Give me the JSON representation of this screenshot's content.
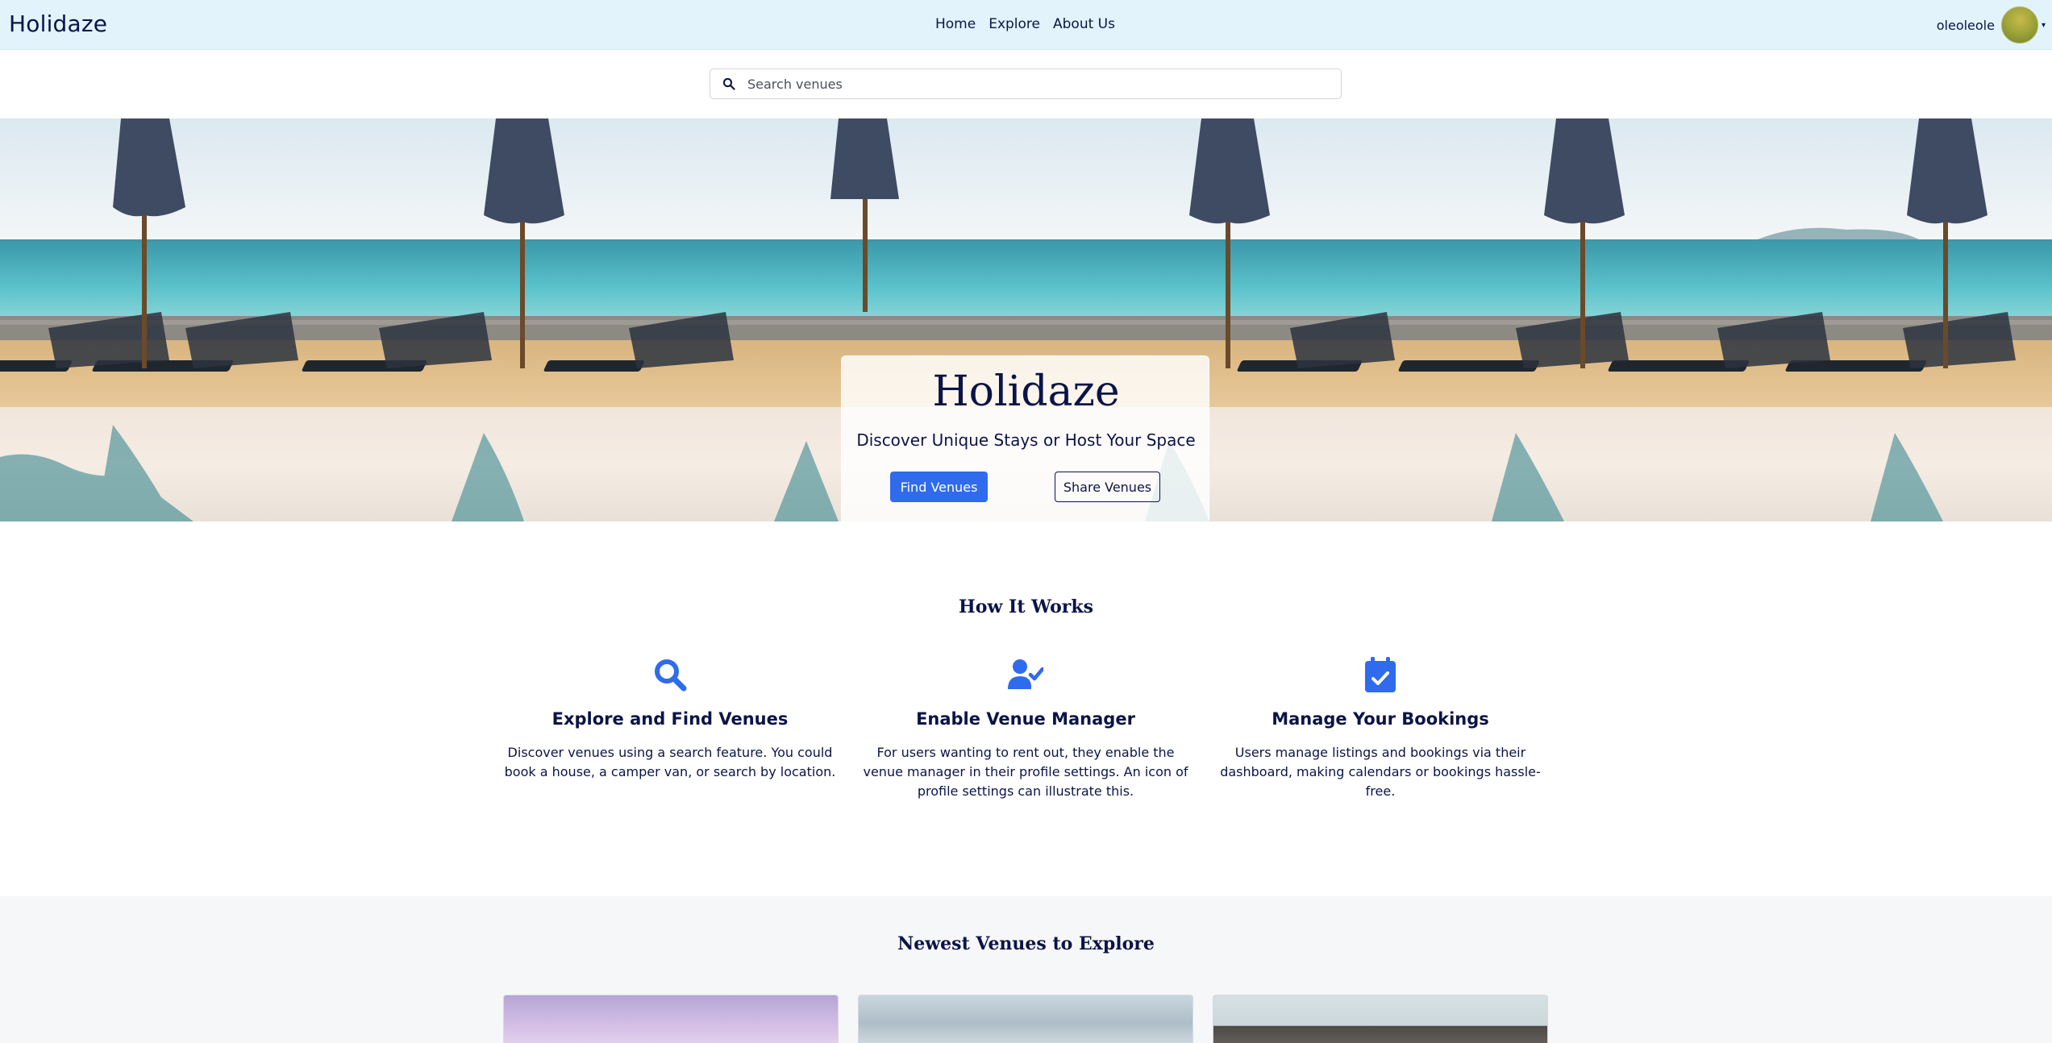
{
  "navbar": {
    "brand": "Holidaze",
    "links": [
      "Home",
      "Explore",
      "About Us"
    ],
    "username": "oleoleole",
    "avatar_icon": "user-avatar",
    "caret_icon": "caret-down-icon"
  },
  "search": {
    "placeholder": "Search venues",
    "icon": "search-icon"
  },
  "hero": {
    "title": "Holidaze",
    "subtitle": "Discover Unique Stays or Host Your Space",
    "primary_button": "Find Venues",
    "secondary_button": "Share Venues"
  },
  "how_it_works": {
    "title": "How It Works",
    "features": [
      {
        "icon": "search-icon",
        "title": "Explore and Find Venues",
        "text": "Discover venues using a search feature. You could book a house, a camper van, or search by location."
      },
      {
        "icon": "user-check-icon",
        "title": "Enable Venue Manager",
        "text": "For users wanting to rent out, they enable the venue manager in their profile settings. An icon of profile settings can illustrate this."
      },
      {
        "icon": "calendar-check-icon",
        "title": "Manage Your Bookings",
        "text": "Users manage listings and bookings via their dashboard, making calendars or bookings hassle-free."
      }
    ]
  },
  "newest": {
    "title": "Newest Venues to Explore"
  },
  "colors": {
    "navbar_bg": "#e2f3fc",
    "primary": "#2f6bec",
    "text": "#0b1446",
    "icon": "#2f6bec",
    "section_bg": "#f6f7f9"
  }
}
